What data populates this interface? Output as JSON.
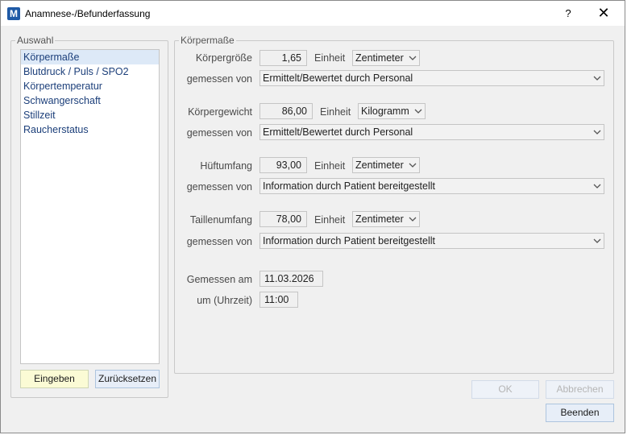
{
  "window": {
    "title": "Anamnese-/Befunderfassung",
    "help_label": "?",
    "close_label": "✕"
  },
  "selection": {
    "legend": "Auswahl",
    "items": [
      {
        "label": "Körpermaße",
        "selected": true
      },
      {
        "label": "Blutdruck / Puls / SPO2",
        "selected": false
      },
      {
        "label": "Körpertemperatur",
        "selected": false
      },
      {
        "label": "Schwangerschaft",
        "selected": false
      },
      {
        "label": "Stillzeit",
        "selected": false
      },
      {
        "label": "Raucherstatus",
        "selected": false
      }
    ],
    "enter_button": "Eingeben",
    "reset_button": "Zurücksetzen"
  },
  "measures": {
    "legend": "Körpermaße",
    "unit_label": "Einheit",
    "measured_by_label": "gemessen von",
    "rows": [
      {
        "label": "Körpergröße",
        "value": "1,65",
        "unit": "Zentimeter",
        "measured_by": "Ermittelt/Bewertet durch Personal"
      },
      {
        "label": "Körpergewicht",
        "value": "86,00",
        "unit": "Kilogramm",
        "measured_by": "Ermittelt/Bewertet durch Personal"
      },
      {
        "label": "Hüftumfang",
        "value": "93,00",
        "unit": "Zentimeter",
        "measured_by": "Information durch Patient bereitgestellt"
      },
      {
        "label": "Taillenumfang",
        "value": "78,00",
        "unit": "Zentimeter",
        "measured_by": "Information durch Patient bereitgestellt"
      }
    ],
    "measured_on_label": "Gemessen am",
    "measured_on_value": "11.03.2026",
    "time_label": "um (Uhrzeit)",
    "time_value": "11:00"
  },
  "footer": {
    "ok_button": "OK",
    "cancel_button": "Abbrechen",
    "finish_button": "Beenden"
  }
}
